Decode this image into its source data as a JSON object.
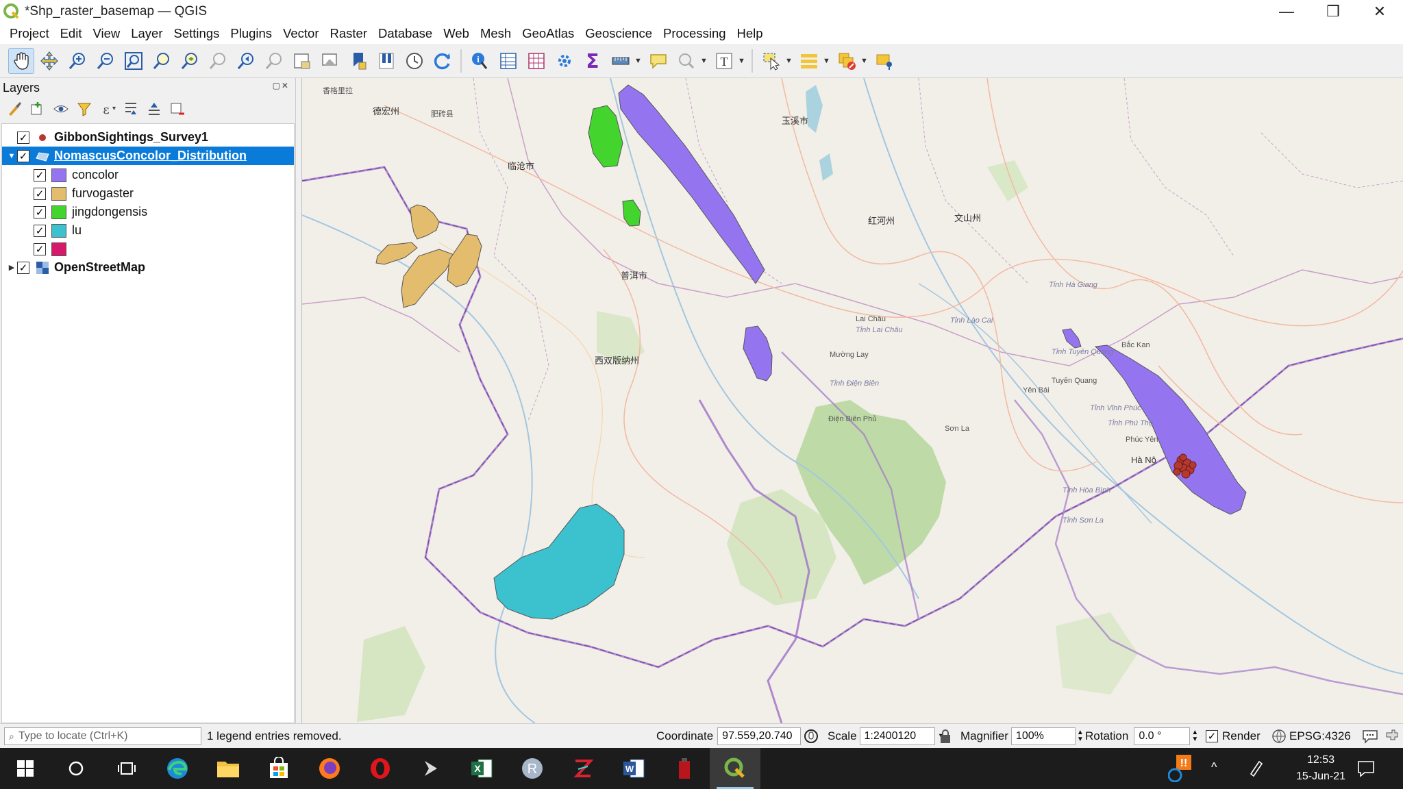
{
  "window": {
    "title": "*Shp_raster_basemap — QGIS",
    "controls": [
      "—",
      "❒",
      "✕"
    ]
  },
  "menubar": {
    "items": [
      "Project",
      "Edit",
      "View",
      "Layer",
      "Settings",
      "Plugins",
      "Vector",
      "Raster",
      "Database",
      "Web",
      "Mesh",
      "GeoAtlas",
      "Geoscience",
      "Processing",
      "Help"
    ]
  },
  "layers_panel": {
    "title": "Layers",
    "layers": [
      {
        "name": "GibbonSightings_Survey1",
        "checked": true
      },
      {
        "name": "NomascusConcolor_Distribution",
        "checked": true,
        "selected": true
      },
      {
        "name": "OpenStreetMap",
        "checked": true
      }
    ],
    "categories": [
      {
        "label": "concolor",
        "color": "#9575ef"
      },
      {
        "label": "furvogaster",
        "color": "#e3bc6d"
      },
      {
        "label": "jingdongensis",
        "color": "#43d42e"
      },
      {
        "label": "lu",
        "color": "#3cc1cf"
      },
      {
        "label": "",
        "color": "#d6196b"
      }
    ]
  },
  "map": {
    "labels": [
      "德宏州",
      "临沧市",
      "普洱市",
      "西双版纳州",
      "玉溪市",
      "红河州",
      "文山州",
      "Lai Châu",
      "Mường Lay",
      "Tỉnh Điện Biên",
      "Điện Biên Phủ",
      "Sơn La",
      "Tuyên Quang",
      "Tỉnh Tuyên Quang",
      "Yên Bái",
      "Hà Nộ",
      "Tỉnh Lai Châu",
      "Tỉnh Hà Giang",
      "Tỉnh Lào Cai",
      "Tỉnh Sơn La",
      "Tỉnh Phú Thọ",
      "Tỉnh Vĩnh Phúc",
      "Tỉnh Hòa Bình",
      "Bắc Kan",
      "Phúc Yên",
      "香格里拉",
      "肥砖县"
    ]
  },
  "statusbar": {
    "locator_placeholder": "Type to locate (Ctrl+K)",
    "message": "1 legend entries removed.",
    "coordinate_label": "Coordinate",
    "coordinate_value": "97.559,20.740",
    "scale_label": "Scale",
    "scale_value": "1:2400120",
    "magnifier_label": "Magnifier",
    "magnifier_value": "100%",
    "rotation_label": "Rotation",
    "rotation_value": "0.0 °",
    "render_label": "Render",
    "crs": "EPSG:4326"
  },
  "taskbar": {
    "time": "12:53",
    "date": "15-Jun-21"
  },
  "colors": {
    "selection": "#0a7bd8",
    "map_background": "#f2efe9",
    "sightings": "#b5392e"
  }
}
